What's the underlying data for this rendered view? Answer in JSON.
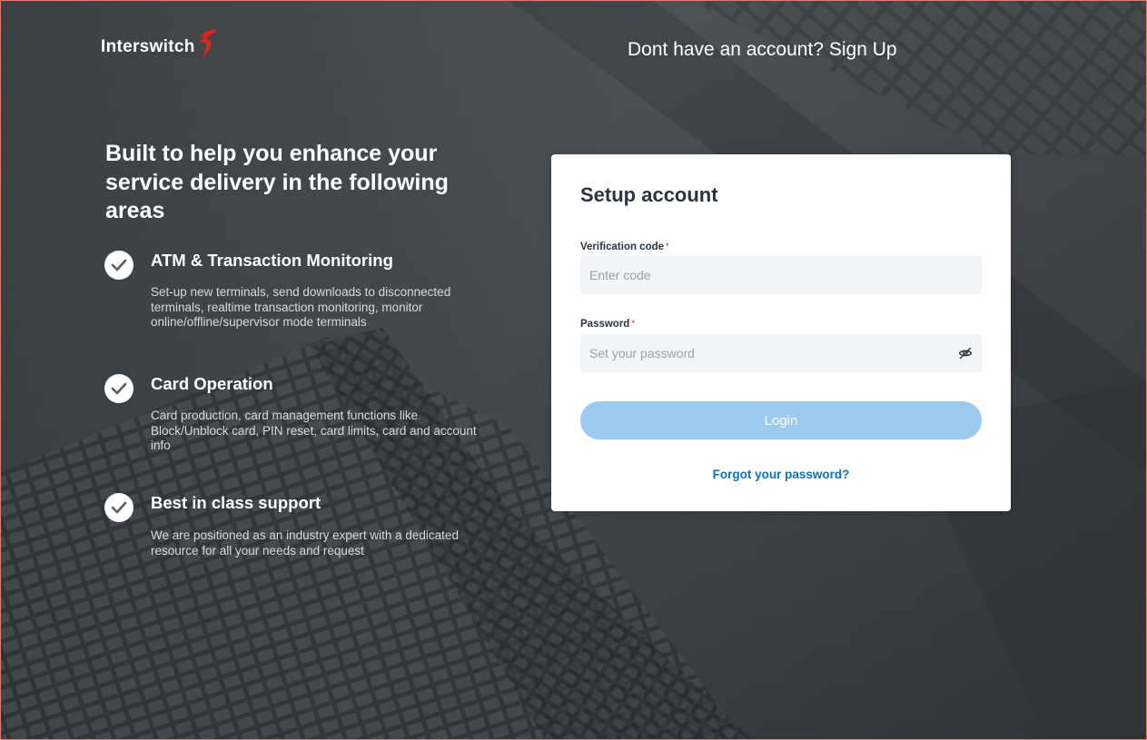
{
  "brand": {
    "name": "Interswitch",
    "logo_icon": "interswitch-swoosh-icon",
    "accent_color": "#e2231a"
  },
  "header": {
    "signup_prompt": "Dont have an account?",
    "signup_link": "Sign Up"
  },
  "hero": {
    "headline": "Built to help you enhance your service delivery in the following areas",
    "features": [
      {
        "icon": "check-circle-icon",
        "title": "ATM & Transaction Monitoring",
        "description": "Set-up new terminals, send downloads to disconnected terminals, realtime transaction monitoring, monitor online/offline/supervisor mode terminals"
      },
      {
        "icon": "check-circle-icon",
        "title": "Card Operation",
        "description": "Card production, card management functions like Block/Unblock card, PIN reset, card limits, card and account info"
      },
      {
        "icon": "check-circle-icon",
        "title": "Best in class support",
        "description": "We are positioned as an industry expert with a dedicated resource for all your needs and request"
      }
    ]
  },
  "form": {
    "title": "Setup account",
    "verification_label": "Verification code",
    "verification_placeholder": "Enter code",
    "verification_value": "",
    "password_label": "Password",
    "password_placeholder": "Set your password",
    "password_value": "",
    "password_visibility_icon": "eye-slash-icon",
    "required_marker": "*",
    "submit_label": "Login",
    "forgot_link": "Forgot your password?",
    "primary_color": "#9dcaf0",
    "link_color": "#0c72c4"
  }
}
